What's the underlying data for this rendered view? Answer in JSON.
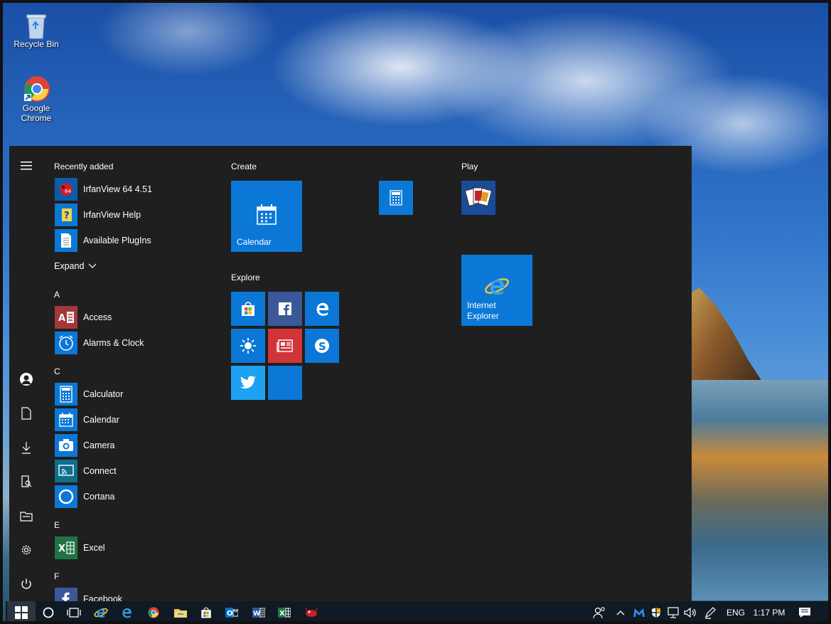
{
  "desktop": {
    "icons": [
      {
        "label": "Recycle Bin"
      },
      {
        "label": "Google Chrome"
      }
    ]
  },
  "start_menu": {
    "recently_added": {
      "heading": "Recently added",
      "items": [
        {
          "label": "IrfanView 64 4.51",
          "icon": "irfanview-icon"
        },
        {
          "label": "IrfanView Help",
          "icon": "help-icon"
        },
        {
          "label": "Available PlugIns",
          "icon": "document-icon"
        }
      ],
      "expand_label": "Expand"
    },
    "sections": [
      {
        "letter": "A",
        "items": [
          {
            "label": "Access",
            "icon": "access-icon"
          },
          {
            "label": "Alarms & Clock",
            "icon": "clock-icon"
          }
        ]
      },
      {
        "letter": "C",
        "items": [
          {
            "label": "Calculator",
            "icon": "calculator-icon"
          },
          {
            "label": "Calendar",
            "icon": "calendar-icon"
          },
          {
            "label": "Camera",
            "icon": "camera-icon"
          },
          {
            "label": "Connect",
            "icon": "connect-icon"
          },
          {
            "label": "Cortana",
            "icon": "cortana-icon"
          }
        ]
      },
      {
        "letter": "E",
        "items": [
          {
            "label": "Excel",
            "icon": "excel-icon"
          }
        ]
      },
      {
        "letter": "F",
        "items": [
          {
            "label": "Facebook",
            "icon": "facebook-icon"
          }
        ]
      }
    ],
    "tile_groups": {
      "create": {
        "heading": "Create",
        "calendar_label": "Calendar"
      },
      "explore": {
        "heading": "Explore"
      },
      "play": {
        "heading": "Play",
        "ie_label_line1": "Internet",
        "ie_label_line2": "Explorer"
      }
    }
  },
  "taskbar": {
    "language": "ENG",
    "time": "1:17 PM"
  },
  "colors": {
    "tile_blue": "#0b78d7",
    "menu_bg": "#1f1f1f",
    "taskbar_bg": "#0f1a24",
    "news_red": "#d13438",
    "twitter_blue": "#1da1f2",
    "excel_green": "#217346",
    "access_red": "#a4373a"
  }
}
